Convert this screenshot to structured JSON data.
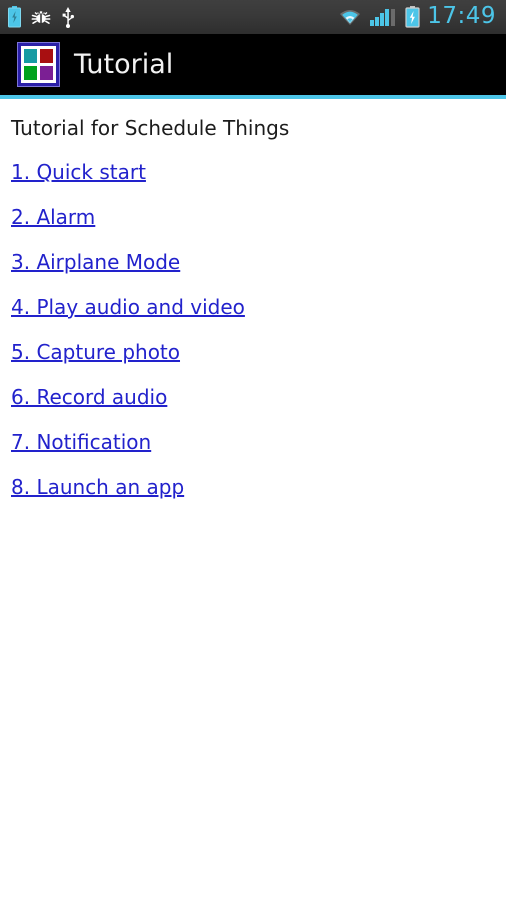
{
  "status_bar": {
    "left_icons": [
      {
        "name": "battery-charging-icon",
        "color": "#4cc5e8"
      },
      {
        "name": "android-debug-bug-icon",
        "color": "#ffffff"
      },
      {
        "name": "usb-icon",
        "color": "#ffffff"
      }
    ],
    "right_icons": [
      {
        "name": "wifi-icon",
        "color": "#4cc5e8"
      },
      {
        "name": "cellular-signal-icon",
        "color": "#4cc5e8"
      },
      {
        "name": "battery-charging-icon",
        "color": "#4cc5e8"
      }
    ],
    "clock": "17:49",
    "background": "#393939",
    "accent_color": "#4cc5e8"
  },
  "action_bar": {
    "title": "Tutorial",
    "background": "#000000",
    "title_color": "#f2f2f2",
    "app_icon": {
      "name": "schedule-things-app-icon",
      "border_color": "#2a1fa8",
      "tiles": [
        "#169ba3",
        "#a80f11",
        "#00a21c",
        "#7b1f94"
      ]
    },
    "accent_rule_color": "#4cc5e8"
  },
  "content": {
    "heading": "Tutorial for Schedule Things",
    "heading_color": "#1c1c1c",
    "link_color": "#2222cc",
    "links": [
      {
        "label": "1. Quick start"
      },
      {
        "label": "2. Alarm"
      },
      {
        "label": "3. Airplane Mode"
      },
      {
        "label": "4. Play audio and video"
      },
      {
        "label": "5. Capture photo"
      },
      {
        "label": "6. Record audio"
      },
      {
        "label": "7. Notification"
      },
      {
        "label": "8. Launch an app"
      }
    ]
  }
}
